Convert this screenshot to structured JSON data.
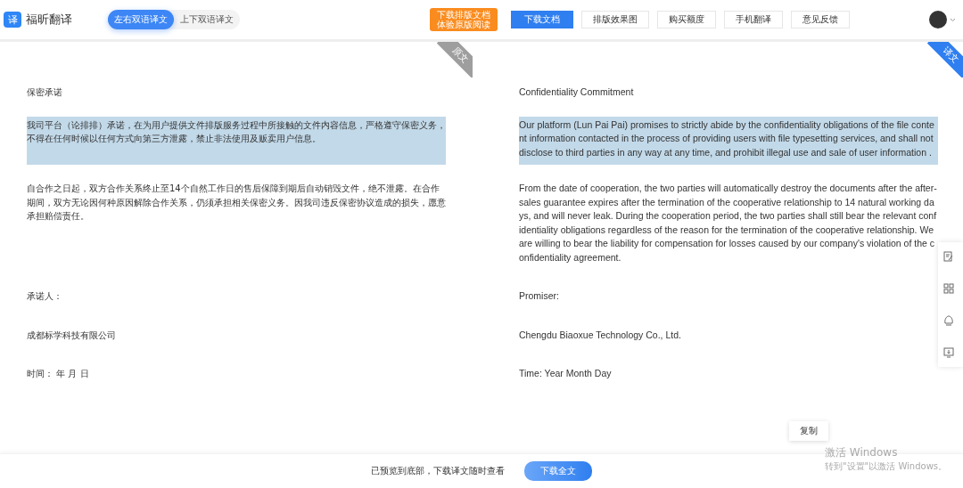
{
  "header": {
    "logo_glyph": "译",
    "app_name": "福昕翻译",
    "view_modes": [
      {
        "label": "左右双语译文",
        "selected": true
      },
      {
        "label": "上下双语译文",
        "selected": false
      }
    ],
    "promo_tooltip": [
      "下载排版文档",
      "体验原版阅读"
    ],
    "actions": [
      {
        "label": "下载文档",
        "primary": true
      },
      {
        "label": "排版效果图",
        "primary": false
      },
      {
        "label": "购买额度",
        "primary": false
      },
      {
        "label": "手机翻译",
        "primary": false
      },
      {
        "label": "意见反馈",
        "primary": false
      }
    ]
  },
  "panes": {
    "source_tag": "原文",
    "target_tag": "译文"
  },
  "rows": [
    {
      "source": "保密承诺",
      "target": "Confidentiality Commitment",
      "highlighted": false
    },
    {
      "source": "我司平台（论排排）承诺，在为用户提供文件排版服务过程中所接触的文件内容信息，严格遵守保密义务，不得在任何时候以任何方式向第三方泄露，禁止非法使用及贩卖用户信息。",
      "target": "Our platform (Lun Pai Pai) promises to strictly abide by the confidentiality obligations of the file content information contacted in the process of providing users with file typesetting services, and shall not disclose to third parties in any way at any time, and prohibit illegal use and sale of user information .",
      "highlighted": true
    },
    {
      "source": "自合作之日起，双方合作关系终止至14个自然工作日的售后保障到期后自动销毁文件，绝不泄露。在合作期间，双方无论因何种原因解除合作关系，仍须承担相关保密义务。因我司违反保密协议造成的损失，愿意承担赔偿责任。",
      "target": "From the date of cooperation, the two parties will automatically destroy the documents after the after-sales guarantee expires after the termination of the cooperative relationship to 14 natural working days, and will never leak. During the cooperation period, the two parties shall still bear the relevant confidentiality obligations regardless of the reason for the termination of the cooperative relationship. We are willing to bear the liability for compensation for losses caused by our company's violation of the confidentiality agreement.",
      "highlighted": false
    },
    {
      "source": "承诺人：",
      "target": "Promiser:",
      "highlighted": false
    },
    {
      "source": "成都标学科技有限公司",
      "target": "Chengdu Biaoxue Technology Co., Ltd.",
      "highlighted": false
    },
    {
      "source": "时间：  年 月 日",
      "target": "Time: Year Month Day",
      "highlighted": false
    }
  ],
  "copy_button": "复制",
  "footer": {
    "message": "已预览到底部，下载译文随时查看",
    "button": "下载全文"
  },
  "os_notice": {
    "title": "激活 Windows",
    "subtitle": "转到\"设置\"以激活 Windows。"
  }
}
